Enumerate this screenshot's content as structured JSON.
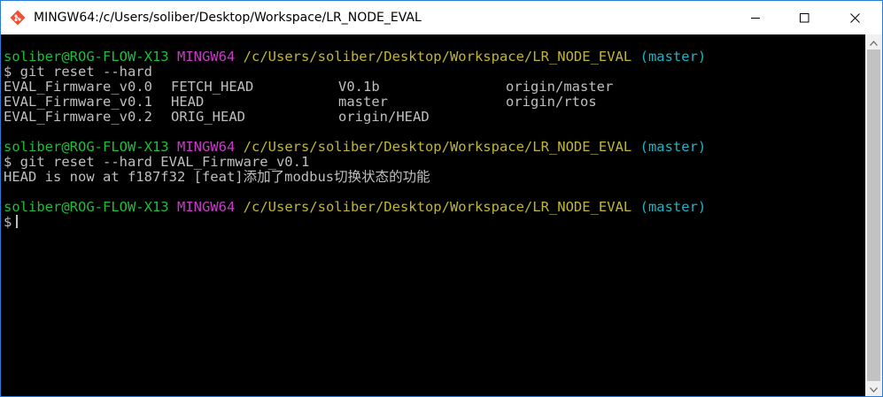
{
  "window": {
    "title": "MINGW64:/c/Users/soliber/Desktop/Workspace/LR_NODE_EVAL",
    "app_icon": "git-bash-icon",
    "controls": {
      "minimize_icon": "minimize-icon",
      "maximize_icon": "maximize-icon",
      "close_icon": "close-icon"
    }
  },
  "terminal": {
    "prompt_1": {
      "user_host": "soliber@ROG-FLOW-X13",
      "system": "MINGW64",
      "path": "/c/Users/soliber/Desktop/Workspace/LR_NODE_EVAL",
      "branch": "(master)"
    },
    "command_1": "$ git reset --hard",
    "completions": [
      [
        "EVAL_Firmware_v0.0",
        "FETCH_HEAD",
        "V0.1b",
        "origin/master"
      ],
      [
        "EVAL_Firmware_v0.1",
        "HEAD",
        "master",
        "origin/rtos"
      ],
      [
        "EVAL_Firmware_v0.2",
        "ORIG_HEAD",
        "origin/HEAD",
        ""
      ]
    ],
    "prompt_2": {
      "user_host": "soliber@ROG-FLOW-X13",
      "system": "MINGW64",
      "path": "/c/Users/soliber/Desktop/Workspace/LR_NODE_EVAL",
      "branch": "(master)"
    },
    "command_2": "$ git reset --hard EVAL_Firmware_v0.1",
    "output_2": "HEAD is now at f187f32 [feat]添加了modbus切换状态的功能",
    "prompt_3": {
      "user_host": "soliber@ROG-FLOW-X13",
      "system": "MINGW64",
      "path": "/c/Users/soliber/Desktop/Workspace/LR_NODE_EVAL",
      "branch": "(master)"
    },
    "input_prompt": "$"
  },
  "colors": {
    "background": "#000000",
    "user_host": "#1dbf3a",
    "system": "#c93ac9",
    "path": "#c1b635",
    "branch": "#1fb4c6",
    "text": "#bfbfbf",
    "border": "#2b7bd4"
  }
}
